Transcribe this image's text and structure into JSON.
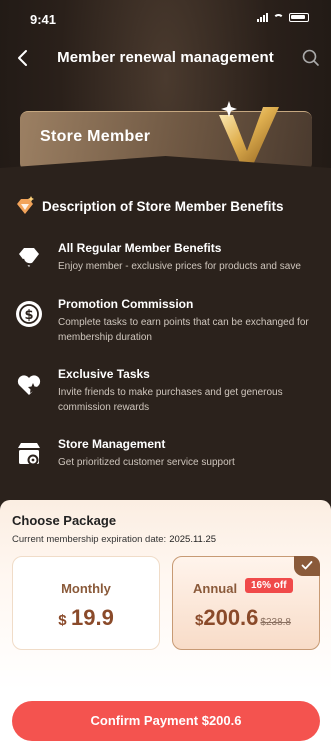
{
  "status_bar": {
    "time": "9:41"
  },
  "nav": {
    "title": "Member renewal management"
  },
  "member_card": {
    "title": "Store Member"
  },
  "benefits": {
    "title": "Description of Store Member Benefits",
    "items": [
      {
        "title": "All Regular Member Benefits",
        "desc": "Enjoy member - exclusive prices for products and save",
        "icon": "refresh-diamond-icon"
      },
      {
        "title": "Promotion Commission",
        "desc": "Complete tasks to earn points that can be exchanged for membership duration",
        "icon": "dollar-coin-icon"
      },
      {
        "title": "Exclusive Tasks",
        "desc": "Invite friends to make purchases and get generous commission rewards",
        "icon": "star-heart-icon"
      },
      {
        "title": "Store Management",
        "desc": "Get prioritized customer service support",
        "icon": "store-gear-icon"
      }
    ]
  },
  "package": {
    "title": "Choose Package",
    "expiry_label": "Current membership expiration date:",
    "expiry_date": "2025.11.25",
    "plans": [
      {
        "name": "Monthly",
        "currency": "$",
        "price": "19.9"
      },
      {
        "name": "Annual",
        "badge": "16% off",
        "currency": "$",
        "price": "200.6",
        "old_price": "$238.8",
        "selected": true
      }
    ]
  },
  "confirm": {
    "label": "Confirm Payment $200.6"
  },
  "colors": {
    "accent": "#f4534f",
    "gold": "#d9a84a",
    "panel": "#2b221c",
    "price": "#8a4a2a"
  }
}
